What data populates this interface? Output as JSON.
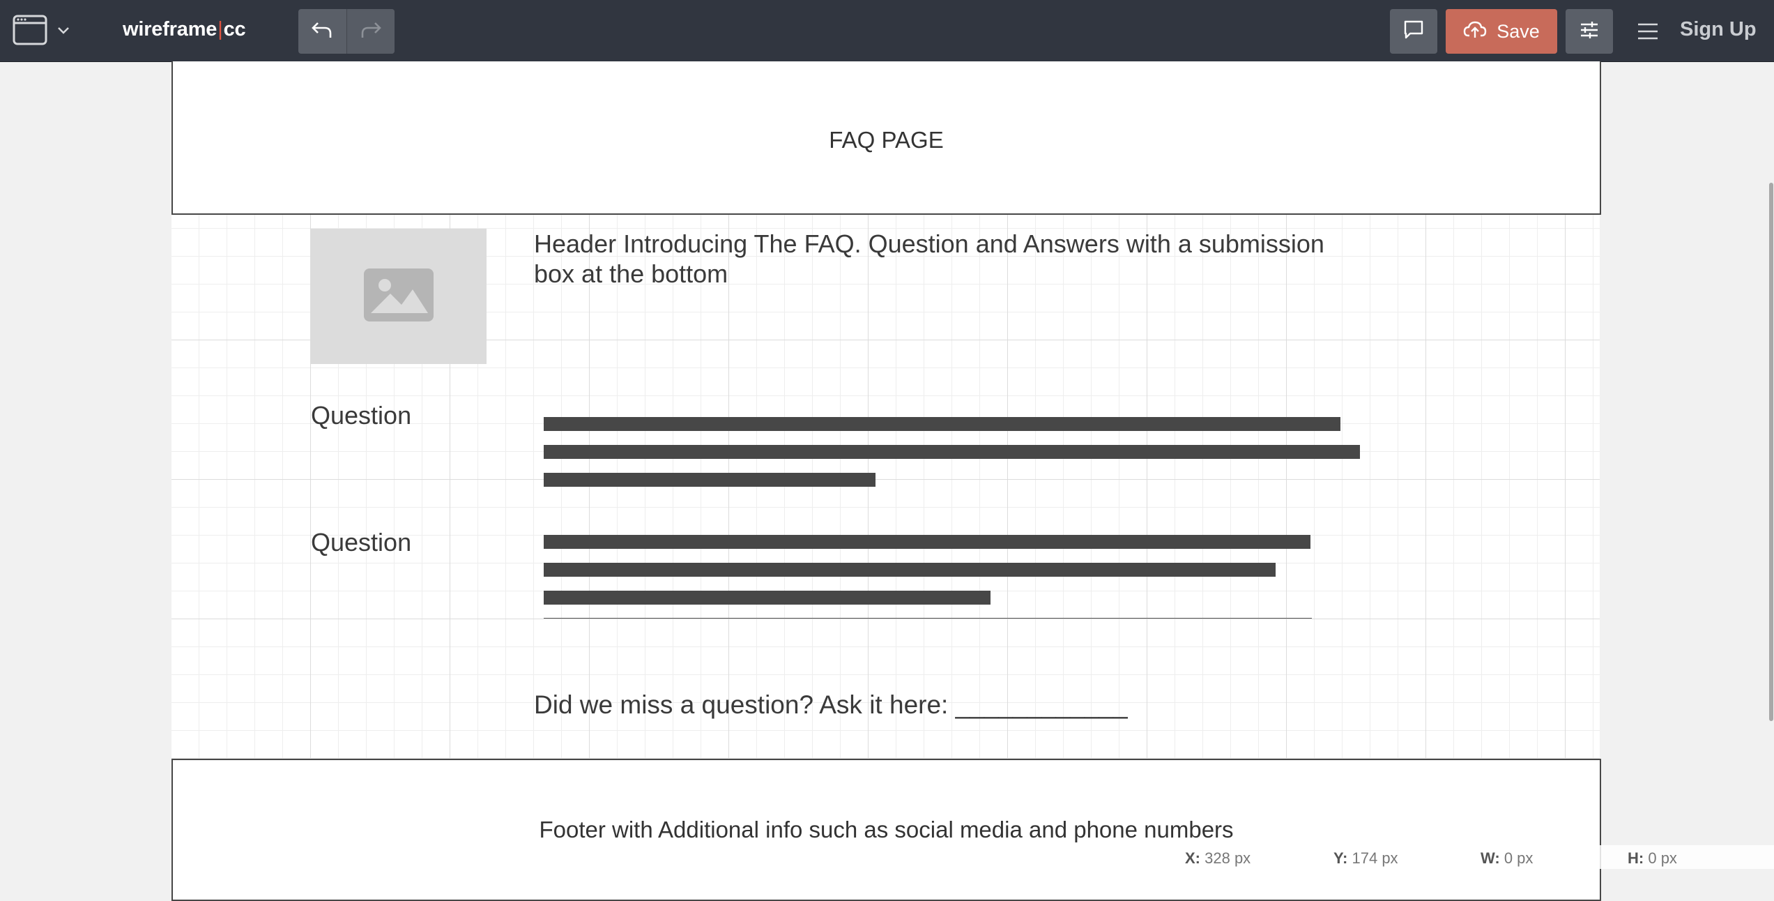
{
  "topbar": {
    "brand_left": "wireframe",
    "brand_sep": "|",
    "brand_right": "cc",
    "save_label": "Save",
    "signup_label": "Sign Up",
    "icons": [
      "browser-window-icon",
      "chevron-down-icon",
      "undo-icon",
      "redo-icon",
      "comment-icon",
      "cloud-upload-icon",
      "sliders-icon",
      "hamburger-menu-icon"
    ]
  },
  "wireframe": {
    "header_title": "FAQ PAGE",
    "intro_text": "Header Introducing The FAQ. Question and Answers with a submission box at the bottom",
    "questions": [
      {
        "label": "Question"
      },
      {
        "label": "Question"
      }
    ],
    "ask_text": "Did we miss a question? Ask it here: ____________",
    "footer_text": "Footer with Additional info such as social media and phone numbers"
  },
  "status": {
    "x_label": "X:",
    "x_value": "328 px",
    "y_label": "Y:",
    "y_value": "174 px",
    "w_label": "W:",
    "w_value": "0 px",
    "h_label": "H:",
    "h_value": "0 px"
  },
  "colors": {
    "topbar_bg": "#313640",
    "save_bg": "#c86b5a",
    "brand_accent": "#e0533f",
    "text_block": "#474747"
  }
}
